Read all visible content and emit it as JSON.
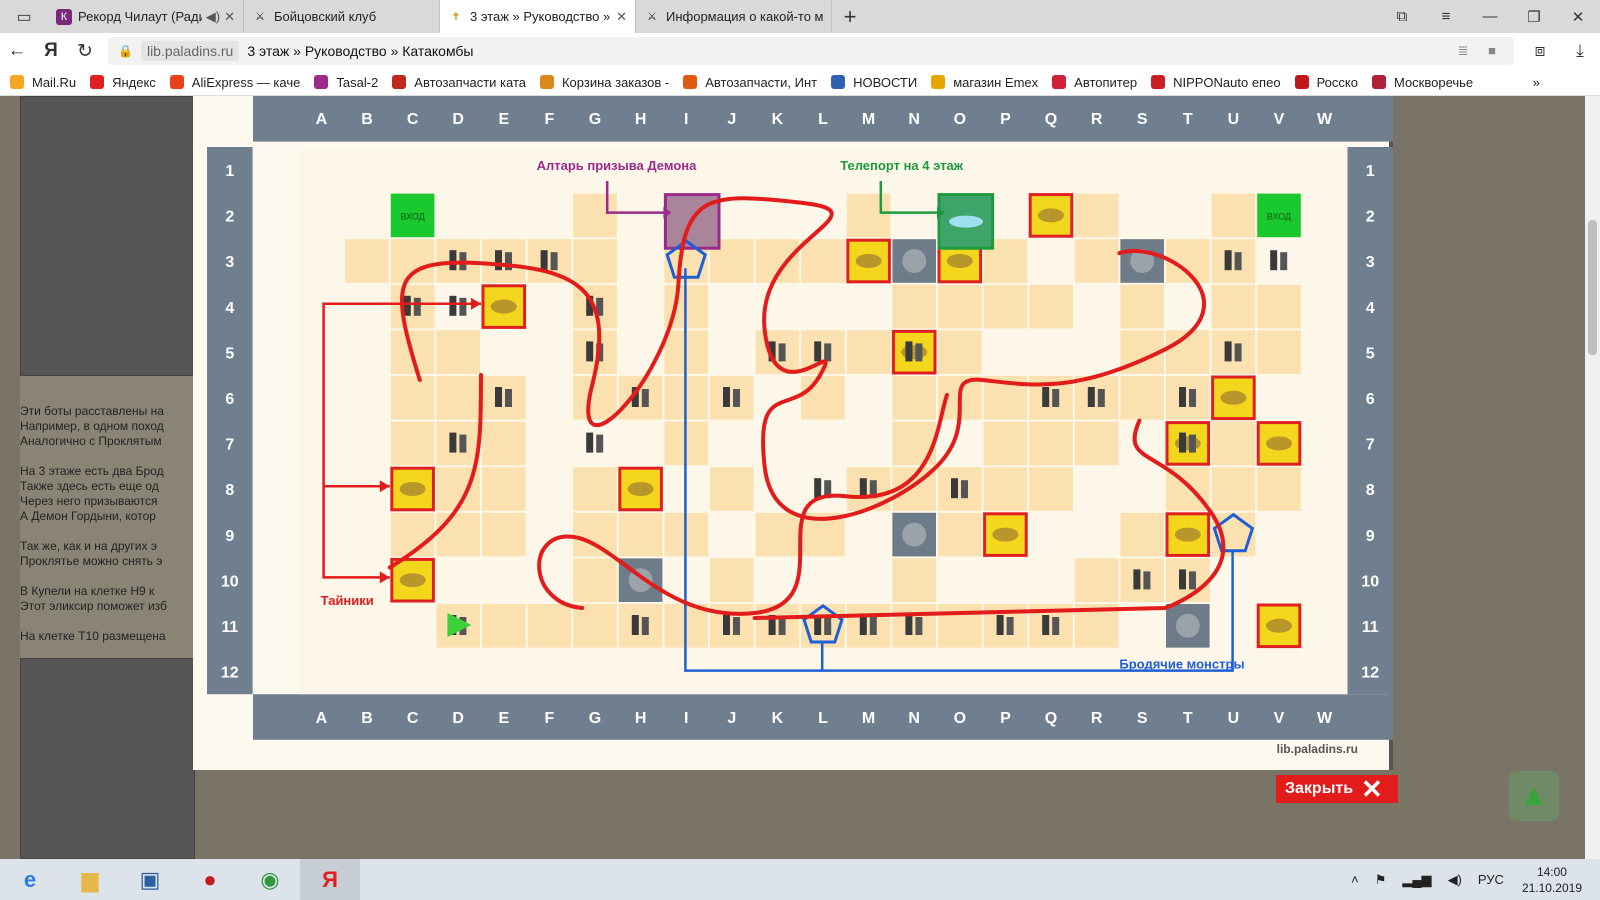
{
  "browser": {
    "tabs": [
      {
        "title": "Рекорд Чилаут (Ради",
        "icon": "radio-icon",
        "active": false
      },
      {
        "title": "Бойцовский клуб",
        "icon": "swords-icon",
        "active": false
      },
      {
        "title": "3 этаж » Руководство »",
        "icon": "cross-icon",
        "active": true
      },
      {
        "title": "Информация о какой-то м",
        "icon": "swords-icon",
        "active": false
      }
    ],
    "url_domain": "lib.paladins.ru",
    "url_title": "3 этаж » Руководство » Катакомбы",
    "bookmarks": [
      {
        "label": "Mail.Ru",
        "color": "#f5a623"
      },
      {
        "label": "Яндекс",
        "color": "#e02020"
      },
      {
        "label": "AliExpress — каче",
        "color": "#e8411c"
      },
      {
        "label": "Tasal-2",
        "color": "#9b2a8a"
      },
      {
        "label": "Автозапчасти ката",
        "color": "#c0281c"
      },
      {
        "label": "Корзина заказов -",
        "color": "#d98a1a"
      },
      {
        "label": "Автозапчасти, Инт",
        "color": "#e05a10"
      },
      {
        "label": "НОВОСТИ",
        "color": "#3060b0"
      },
      {
        "label": "магазин Emex",
        "color": "#e5a800"
      },
      {
        "label": "Автопитер",
        "color": "#d0203a"
      },
      {
        "label": "NIPPONauto епео",
        "color": "#c82020"
      },
      {
        "label": "Росско",
        "color": "#c01818"
      },
      {
        "label": "Москворечье",
        "color": "#b0203a"
      }
    ]
  },
  "background_text": [
    "Эти боты расставлены на",
    "Например, в одном поход",
    "Аналогично с Проклятым",
    "",
    "На 3 этаже есть два Брод",
    "Также здесь есть еще од",
    "Через него призываются",
    "А Демон Гордыни, котор",
    "",
    "Так же, как и на других э",
    "Проклятье можно снять э",
    "",
    "В Купели на клетке H9 к",
    "Этот эликсир поможет изб",
    "",
    "На клетке T10 размещена"
  ],
  "map": {
    "columns": [
      "A",
      "B",
      "C",
      "D",
      "E",
      "F",
      "G",
      "H",
      "I",
      "J",
      "K",
      "L",
      "M",
      "N",
      "O",
      "P",
      "Q",
      "R",
      "S",
      "T",
      "U",
      "V",
      "W"
    ],
    "rows": [
      "1",
      "2",
      "3",
      "4",
      "5",
      "6",
      "7",
      "8",
      "9",
      "10",
      "11",
      "12"
    ],
    "labels": {
      "altar": "Алтарь призыва Демона",
      "teleport": "Телепорт на 4 этаж",
      "caches": "Тайники",
      "wandering": "Бродячие монстры",
      "entrance": "ВХОД",
      "watermark": "lib.paladins.ru"
    },
    "colors": {
      "floor": "#fbe1b0",
      "header": "#6f7f8f",
      "cache_border": "#e02020",
      "route": "#e21b1b",
      "wander_path": "#1f5fd6",
      "altar": "#9b2a8a",
      "teleport": "#1d9a3d"
    }
  },
  "close_button": {
    "label": "Закрыть"
  },
  "taskbar": {
    "apps": [
      "ie-icon",
      "folder-icon",
      "monitor-icon",
      "media-icon",
      "chrome-icon",
      "yandex-icon"
    ],
    "lang": "РУС",
    "time": "14:00",
    "date": "21.10.2019"
  }
}
